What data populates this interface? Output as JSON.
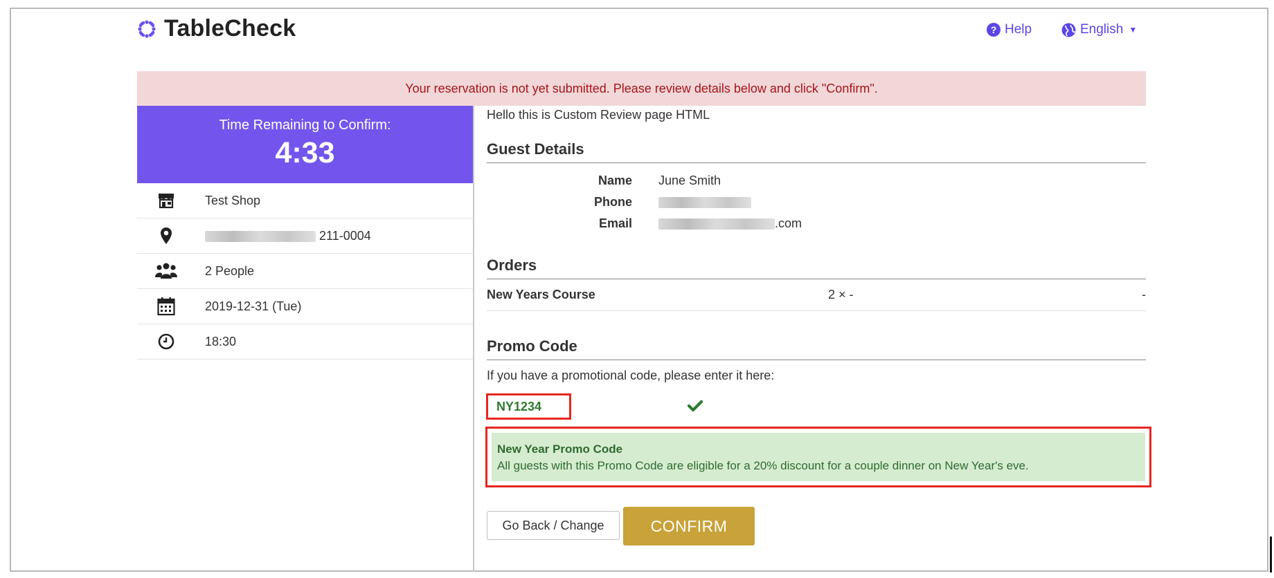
{
  "header": {
    "logo_text": "TableCheck",
    "help_label": "Help",
    "language_label": "English"
  },
  "alert": {
    "message": "Your reservation is not yet submitted. Please review details below and click \"Confirm\"."
  },
  "timer": {
    "label": "Time Remaining to Confirm:",
    "value": "4:33"
  },
  "reservation": {
    "shop": "Test Shop",
    "address_suffix": "211-0004",
    "people": "2 People",
    "date": "2019-12-31 (Tue)",
    "time": "18:30"
  },
  "main": {
    "custom_html": "Hello this is Custom Review page HTML",
    "guest_details_title": "Guest Details",
    "guest": {
      "name_label": "Name",
      "name_value": "June Smith",
      "phone_label": "Phone",
      "email_label": "Email",
      "email_suffix": ".com"
    },
    "orders_title": "Orders",
    "orders": [
      {
        "name": "New Years Course",
        "qty": "2 × -",
        "price": "-"
      }
    ],
    "promo_title": "Promo Code",
    "promo_help": "If you have a promotional code, please enter it here:",
    "promo_code": "NY1234",
    "promo_result_title": "New Year Promo Code",
    "promo_result_desc": "All guests with this Promo Code are eligible for a 20% discount for a couple dinner on New Year's eve."
  },
  "buttons": {
    "back": "Go Back / Change",
    "confirm": "CONFIRM"
  },
  "colors": {
    "brand_purple": "#7355ee",
    "link": "#5b46e8",
    "alert_bg": "#f2d7d8",
    "alert_text": "#a8141b",
    "success_bg": "#d6ecd1",
    "success_text": "#2e6b2e",
    "confirm_gold": "#c9a239",
    "highlight_red": "#e5261f"
  },
  "icons": [
    "logo-icon",
    "help-icon",
    "globe-icon",
    "shop-icon",
    "map-pin-icon",
    "people-icon",
    "calendar-icon",
    "clock-icon",
    "checkmark-icon"
  ]
}
